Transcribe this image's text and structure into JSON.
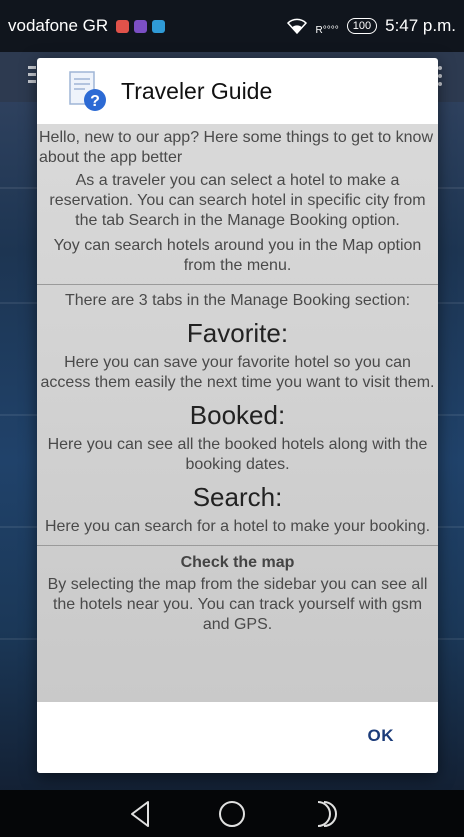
{
  "status_bar": {
    "carrier": "vodafone GR",
    "signal_text": "R",
    "battery": "100",
    "time": "5:47 p.m."
  },
  "dialog": {
    "title": "Traveler Guide",
    "intro": "Hello, new to our app? Here some things to get to know about the app better",
    "para_search": "As a traveler you can select a hotel to make a reservation. You can search hotel in  specific city from the tab Search in the Manage Booking option.",
    "para_map": "Yoy can search hotels around you in the Map option from the menu.",
    "tabs_intro": "There are 3 tabs in the Manage Booking section:",
    "favorite_heading": "Favorite:",
    "favorite_text": "Here you can save your favorite hotel so you can access them easily the next time you want to visit them.",
    "booked_heading": "Booked:",
    "booked_text": "Here you can see all the booked hotels along with the booking dates.",
    "search_heading": "Search:",
    "search_text": "Here you can search for a hotel to make your booking.",
    "map_heading": "Check the map",
    "map_text": "By selecting the map from the sidebar you can see all the hotels near you. You can track yourself with gsm and GPS.",
    "ok_label": "OK"
  },
  "icons": {
    "help": "help-document-icon",
    "nav_back": "back-icon",
    "nav_home": "home-icon",
    "nav_recents": "recents-icon"
  },
  "colors": {
    "accent": "#1c3c7a",
    "dialog_body_bg": "#d3d3d3",
    "status_bar_bg": "#10151d"
  }
}
